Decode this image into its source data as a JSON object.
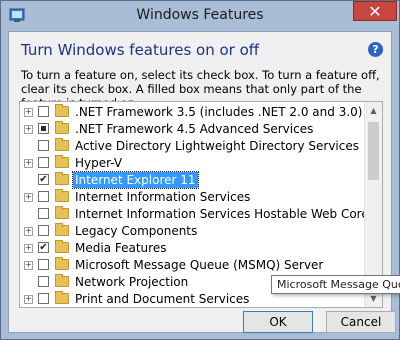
{
  "window": {
    "title": "Windows Features",
    "close_glyph": "✕"
  },
  "dialog": {
    "heading": "Turn Windows features on or off",
    "help_glyph": "?",
    "description": "To turn a feature on, select its check box. To turn a feature off, clear its check box. A filled box means that only part of the feature is turned on."
  },
  "features": [
    {
      "label": ".NET Framework 3.5 (includes .NET 2.0 and 3.0)",
      "expandable": true,
      "state": "unchecked",
      "selected": false
    },
    {
      "label": ".NET Framework 4.5 Advanced Services",
      "expandable": true,
      "state": "partial",
      "selected": false
    },
    {
      "label": "Active Directory Lightweight Directory Services",
      "expandable": false,
      "state": "unchecked",
      "selected": false
    },
    {
      "label": "Hyper-V",
      "expandable": true,
      "state": "unchecked",
      "selected": false
    },
    {
      "label": "Internet Explorer 11",
      "expandable": false,
      "state": "checked",
      "selected": true
    },
    {
      "label": "Internet Information Services",
      "expandable": true,
      "state": "unchecked",
      "selected": false
    },
    {
      "label": "Internet Information Services Hostable Web Core",
      "expandable": false,
      "state": "unchecked",
      "selected": false
    },
    {
      "label": "Legacy Components",
      "expandable": true,
      "state": "unchecked",
      "selected": false
    },
    {
      "label": "Media Features",
      "expandable": true,
      "state": "checked",
      "selected": false
    },
    {
      "label": "Microsoft Message Queue (MSMQ) Server",
      "expandable": true,
      "state": "unchecked",
      "selected": false
    },
    {
      "label": "Network Projection",
      "expandable": false,
      "state": "unchecked",
      "selected": false
    },
    {
      "label": "Print and Document Services",
      "expandable": true,
      "state": "unchecked",
      "selected": false
    }
  ],
  "tooltip": "Microsoft Message Queue",
  "buttons": {
    "ok": "OK",
    "cancel": "Cancel"
  },
  "scrollbar": {
    "up_glyph": "▲",
    "down_glyph": "▼"
  },
  "colors": {
    "heading": "#1e3287",
    "selection": "#3399ff",
    "close_button": "#c7463f"
  }
}
